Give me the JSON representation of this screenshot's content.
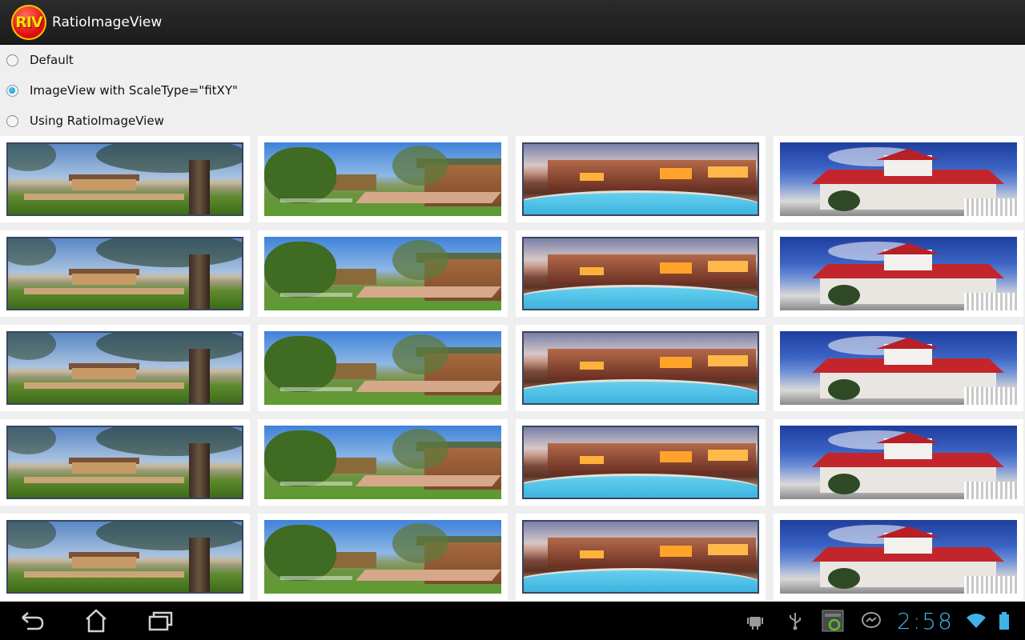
{
  "app": {
    "logo_text": "RIV",
    "title": "RatioImageView"
  },
  "options": [
    {
      "label": "Default",
      "checked": false
    },
    {
      "label": "ImageView with ScaleType=\"fitXY\"",
      "checked": true
    },
    {
      "label": "Using RatioImageView",
      "checked": false
    }
  ],
  "grid": {
    "photos": [
      "garden-tree-photo",
      "side-garden-photo",
      "pool-house-photo",
      "red-roof-house-photo"
    ]
  },
  "system_bar": {
    "nav_icons": [
      "back-icon",
      "home-icon",
      "recent-apps-icon"
    ],
    "status_icons": [
      "android-debug-icon",
      "usb-icon",
      "screenshot-icon",
      "messenger-icon",
      "wifi-icon",
      "battery-icon"
    ],
    "time": "2:58",
    "accent_color": "#3fb3e6"
  }
}
